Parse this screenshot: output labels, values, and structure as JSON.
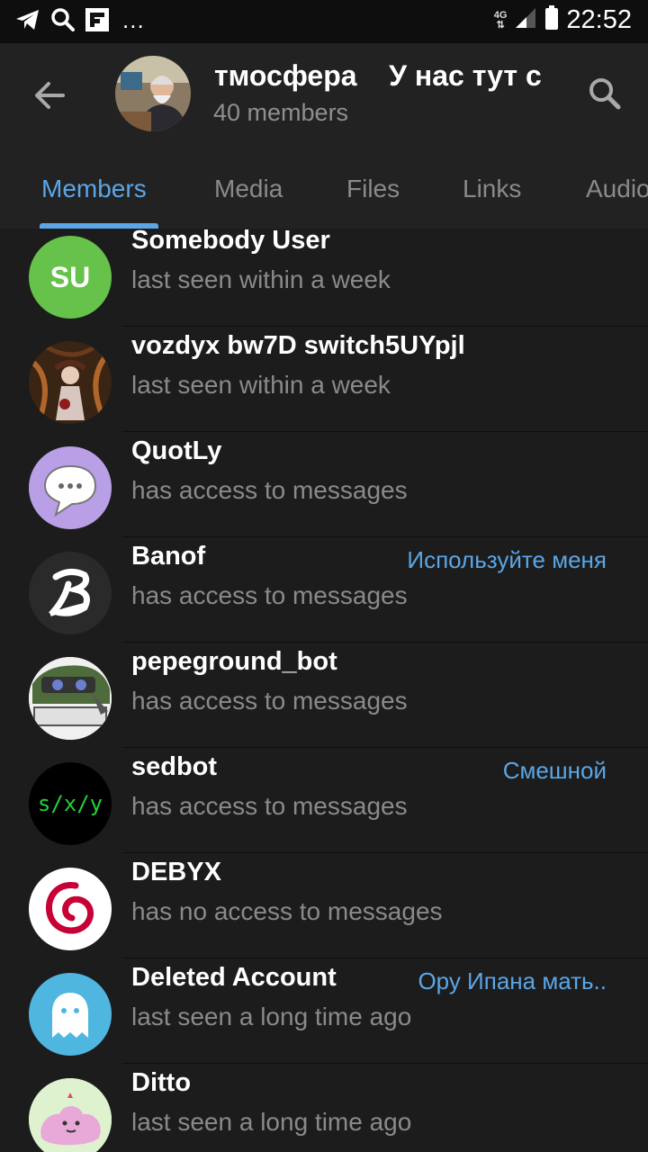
{
  "status_bar": {
    "overflow": "...",
    "network": "4G",
    "time": "22:52",
    "icons": [
      "telegram-icon",
      "search-icon",
      "flipboard-icon",
      "signal-icon",
      "battery-icon"
    ]
  },
  "header": {
    "title": "тмосфера    У нас тут с",
    "subtitle": "40 members"
  },
  "tabs": [
    "Members",
    "Media",
    "Files",
    "Links",
    "Audio"
  ],
  "members": [
    {
      "name": "Somebody User",
      "status": "last seen within a week",
      "tag": "",
      "avatar": {
        "type": "initials",
        "text": "SU",
        "color": "#66c24a"
      }
    },
    {
      "name": "vozdyx bw7D switch5UYpjl",
      "status": "last seen within a week",
      "tag": "",
      "avatar": {
        "type": "image",
        "icon": "anime-figure-avatar"
      }
    },
    {
      "name": "QuotLy",
      "status": "has access to messages",
      "tag": "",
      "avatar": {
        "type": "icon",
        "icon": "speech-bubble-icon",
        "color": "#b9a0e6"
      }
    },
    {
      "name": "Banof",
      "status": "has access to messages",
      "tag": "Используйте меня",
      "avatar": {
        "type": "icon",
        "icon": "letter-b-logo",
        "color": "#2a2a2a"
      }
    },
    {
      "name": "pepeground_bot",
      "status": "has access to messages",
      "tag": "",
      "avatar": {
        "type": "image",
        "icon": "pepe-frog-avatar"
      }
    },
    {
      "name": "sedbot",
      "status": "has access to messages",
      "tag": "Смешной",
      "avatar": {
        "type": "text",
        "text": "s/x/y",
        "color": "#000000"
      }
    },
    {
      "name": "DEBYX",
      "status": "has no access to messages",
      "tag": "",
      "avatar": {
        "type": "icon",
        "icon": "debian-swirl-logo",
        "color": "#ffffff"
      }
    },
    {
      "name": "Deleted Account",
      "status": "last seen a long time ago",
      "tag": "Ору Ипана мать..",
      "avatar": {
        "type": "icon",
        "icon": "ghost-icon",
        "color": "#4fb6e0"
      }
    },
    {
      "name": "Ditto",
      "status": "last seen a long time ago",
      "tag": "",
      "avatar": {
        "type": "image",
        "icon": "ditto-pokemon-avatar"
      }
    }
  ],
  "colors": {
    "accent": "#5aa6e7",
    "background": "#1c1c1c",
    "header": "#222222",
    "secondary_text": "#8a8a8a"
  }
}
